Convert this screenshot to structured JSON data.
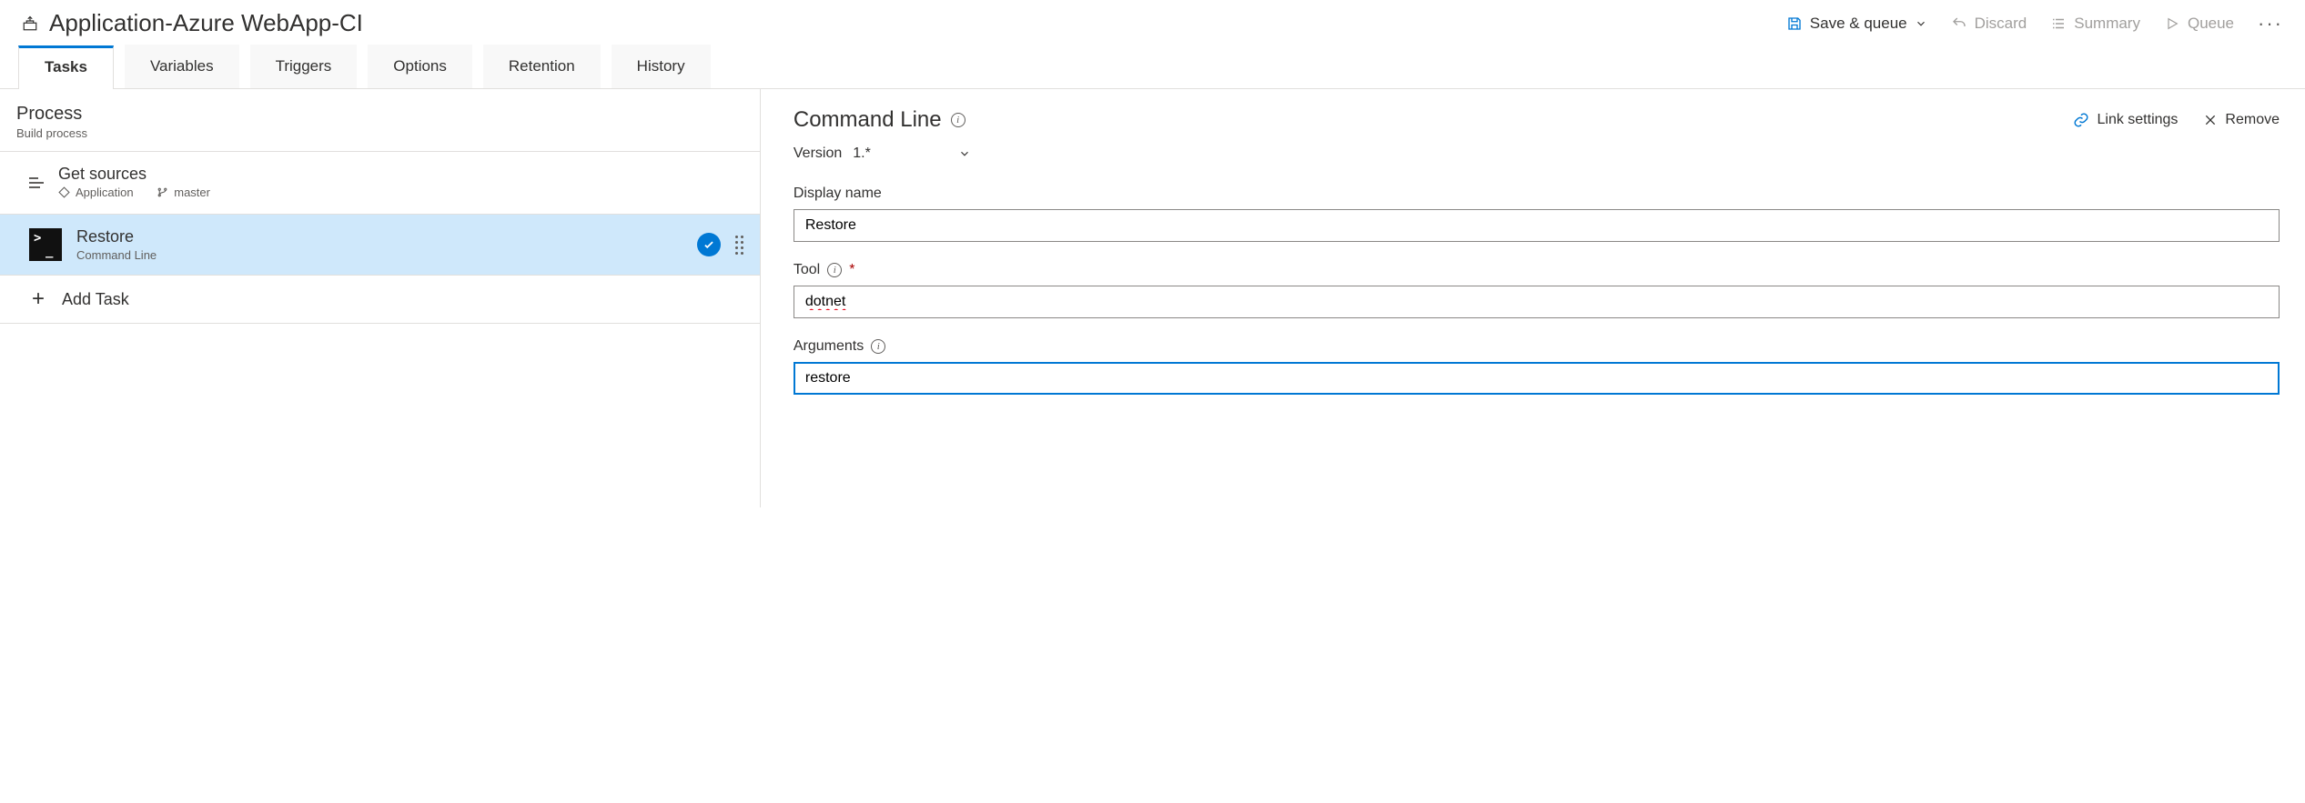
{
  "header": {
    "pipeline_title": "Application-Azure WebApp-CI",
    "toolbar": {
      "save_queue_label": "Save & queue",
      "discard_label": "Discard",
      "summary_label": "Summary",
      "queue_label": "Queue"
    }
  },
  "tabs": [
    "Tasks",
    "Variables",
    "Triggers",
    "Options",
    "Retention",
    "History"
  ],
  "left": {
    "process_title": "Process",
    "process_sub": "Build process",
    "get_sources": {
      "title": "Get sources",
      "repo": "Application",
      "branch": "master"
    },
    "tasks": [
      {
        "title": "Restore",
        "type": "Command Line",
        "selected": true
      }
    ],
    "add_task_label": "Add Task"
  },
  "right": {
    "title": "Command Line",
    "version_label": "Version",
    "version_value": "1.*",
    "link_settings_label": "Link settings",
    "remove_label": "Remove",
    "fields": {
      "display_name": {
        "label": "Display name",
        "value": "Restore"
      },
      "tool": {
        "label": "Tool",
        "value": "dotnet",
        "required": true
      },
      "arguments": {
        "label": "Arguments",
        "value": "restore",
        "active": true
      }
    }
  }
}
